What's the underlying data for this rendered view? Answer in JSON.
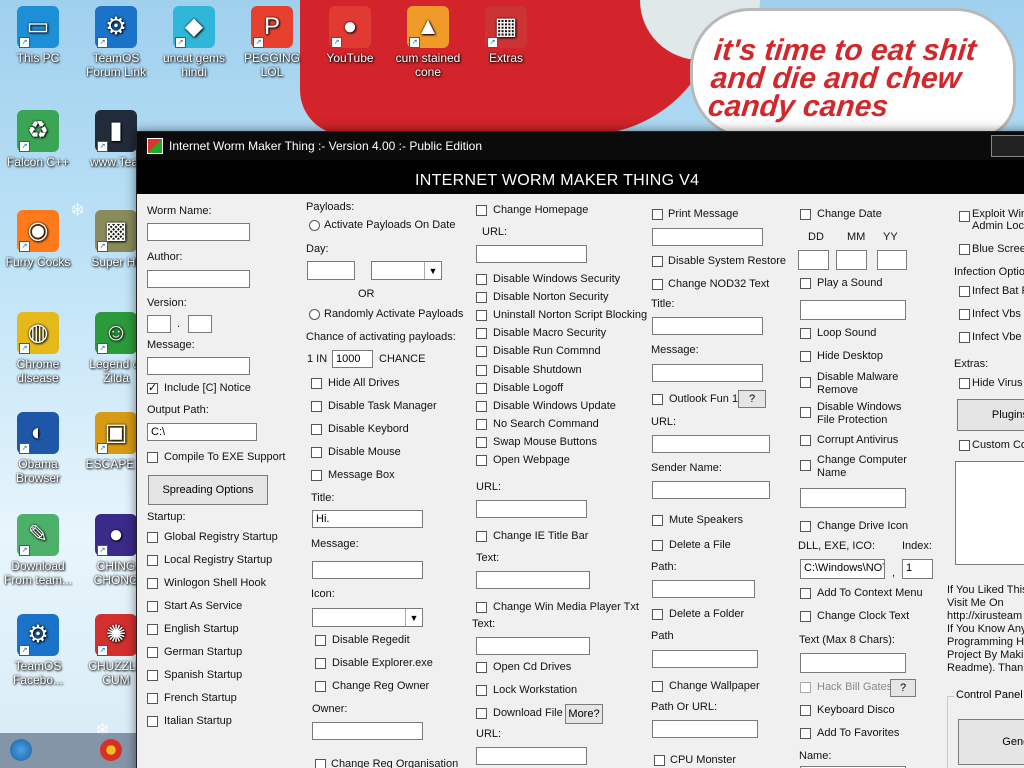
{
  "desktop": {
    "bubble_text": "it's time to eat shit and die and chew candy canes",
    "icons": [
      {
        "label": "This PC",
        "color": "#1d8fd6",
        "glyph": "▭"
      },
      {
        "label": "TeamOS Forum Link",
        "color": "#1a73c9",
        "glyph": "⚙"
      },
      {
        "label": "uncut gems hindi",
        "color": "#2fb6d8",
        "glyph": "◆"
      },
      {
        "label": "PEGGING LOL",
        "color": "#e8402f",
        "glyph": "P"
      },
      {
        "label": "YouTube",
        "color": "#e03a33",
        "glyph": "●"
      },
      {
        "label": "cum stained cone",
        "color": "#f09a2a",
        "glyph": "▲"
      },
      {
        "label": "Extras",
        "color": "#cc3333",
        "glyph": "▦"
      },
      {
        "label": "Falcon C++",
        "color": "#3aa655",
        "glyph": "♻"
      },
      {
        "label": "www.Tear",
        "color": "#222b3a",
        "glyph": "▮"
      },
      {
        "label": "Furry Cocks",
        "color": "#ff7a1a",
        "glyph": "◉"
      },
      {
        "label": "Super Hil",
        "color": "#8a8a5a",
        "glyph": "▩"
      },
      {
        "label": "Chrome disease",
        "color": "#e5b81c",
        "glyph": "◍"
      },
      {
        "label": "Legend of Zilda",
        "color": "#2b9a3a",
        "glyph": "☺"
      },
      {
        "label": "Obama Browser",
        "color": "#1e57a8",
        "glyph": "◐"
      },
      {
        "label": "ESCAPE C",
        "color": "#d89a14",
        "glyph": "▣"
      },
      {
        "label": "Download From team...",
        "color": "#4caf6a",
        "glyph": "✎"
      },
      {
        "label": "CHING CHONG",
        "color": "#3a2a8a",
        "glyph": "●"
      },
      {
        "label": "TeamOS Facebo...",
        "color": "#1a73c9",
        "glyph": "⚙"
      },
      {
        "label": "CHUZZLE CUM",
        "color": "#d32f2f",
        "glyph": "✺"
      }
    ]
  },
  "window": {
    "title": "Internet Worm Maker Thing :- Version 4.00 :- Public Edition",
    "banner": "INTERNET WORM MAKER THING V4"
  },
  "col1": {
    "worm_name_label": "Worm Name:",
    "author_label": "Author:",
    "version_label": "Version:",
    "version_sep": ".",
    "message_label": "Message:",
    "include_notice_label": "Include [C] Notice",
    "output_path_label": "Output Path:",
    "output_path_value": "C:\\",
    "compile_label": "Compile To EXE Support",
    "spreading_button": "Spreading Options",
    "startup_label": "Startup:",
    "startup_items": [
      "Global Registry Startup",
      "Local Registry Startup",
      "Winlogon Shell Hook",
      "Start As Service",
      "English Startup",
      "German Startup",
      "Spanish Startup",
      "French Startup",
      "Italian Startup"
    ]
  },
  "col2": {
    "payloads_label": "Payloads:",
    "activate_on_date": "Activate Payloads On Date",
    "day_label": "Day:",
    "or_label": "OR",
    "random_activate": "Randomly Activate Payloads",
    "chance_label": "Chance of activating payloads:",
    "one_in": "1 IN",
    "chance_value": "1000",
    "chance_suffix": "CHANCE",
    "items": [
      "Hide All Drives",
      "Disable Task Manager",
      "Disable Keybord",
      "Disable Mouse",
      "Message Box"
    ],
    "title_label": "Title:",
    "title_value": "Hi.",
    "message_label": "Message:",
    "icon_label": "Icon:",
    "items2": [
      "Disable Regedit",
      "Disable Explorer.exe",
      "Change Reg Owner"
    ],
    "owner_label": "Owner:",
    "change_reg_org": "Change Reg Organisation"
  },
  "col3": {
    "change_homepage": "Change Homepage",
    "url_label": "URL:",
    "items": [
      "Disable Windows Security",
      "Disable Norton Security",
      "Uninstall Norton Script Blocking",
      "Disable Macro Security",
      "Disable Run Commnd",
      "Disable Shutdown",
      "Disable Logoff",
      "Disable Windows Update",
      "No Search Command",
      "Swap Mouse Buttons",
      "Open Webpage"
    ],
    "url2_label": "URL:",
    "change_ie_title": "Change IE Title Bar",
    "text_label": "Text:",
    "change_wmp": "Change Win Media Player Txt",
    "text2_label": "Text:",
    "open_cd": "Open Cd Drives",
    "lock_ws": "Lock Workstation",
    "download_file": "Download File",
    "more_button": "More?",
    "url3_label": "URL:"
  },
  "col4": {
    "print_message": "Print Message",
    "disable_sys_restore": "Disable System Restore",
    "change_nod32": "Change NOD32 Text",
    "title_label": "Title:",
    "message_label": "Message:",
    "outlook_fun": "Outlook Fun 1",
    "help_button": "?",
    "url_label": "URL:",
    "sender_label": "Sender Name:",
    "mute_speakers": "Mute Speakers",
    "delete_file": "Delete a File",
    "path_label": "Path:",
    "delete_folder": "Delete a Folder",
    "path2_label": "Path",
    "change_wallpaper": "Change Wallpaper",
    "path_or_url": "Path Or URL:",
    "cpu_monster": "CPU Monster"
  },
  "col5": {
    "change_date": "Change Date",
    "dd": "DD",
    "mm": "MM",
    "yy": "YY",
    "play_sound": "Play a Sound",
    "loop_sound": "Loop Sound",
    "hide_desktop": "Hide Desktop",
    "disable_malware": "Disable Malware Remove",
    "disable_wfp": "Disable Windows File Protection",
    "corrupt_av": "Corrupt Antivirus",
    "change_comp_name": "Change Computer Name",
    "change_drive_icon": "Change Drive Icon",
    "dll_label": "DLL, EXE, ICO:",
    "index_label": "Index:",
    "dll_value": "C:\\Windows\\NOT",
    "comma": ",",
    "index_value": "1",
    "add_context": "Add To Context Menu",
    "change_clock": "Change Clock Text",
    "text_max_label": "Text (Max 8 Chars):",
    "hack_bill": "Hack Bill Gates",
    "help_button": "?",
    "keyboard_disco": "Keyboard Disco",
    "add_favorites": "Add To Favorites",
    "name_label": "Name:"
  },
  "col6": {
    "exploit": "Exploit Win Admin Lock",
    "blue_screen": "Blue Screen",
    "infection_label": "Infection Optio",
    "infect_bat": "Infect Bat F",
    "infect_vbs": "Infect Vbs F",
    "infect_vbe": "Infect Vbe F",
    "extras_label": "Extras:",
    "hide_virus": "Hide Virus P",
    "plugins_button": "Plugins",
    "custom_code": "Custom Co",
    "info_text": [
      "If You Liked This",
      "Visit Me On",
      "http://xirusteam",
      "If You Know Any",
      "Programming He",
      "Project By Makin",
      "Readme). Thank"
    ],
    "control_panel": "Control Panel",
    "generate_button": "Genera"
  }
}
